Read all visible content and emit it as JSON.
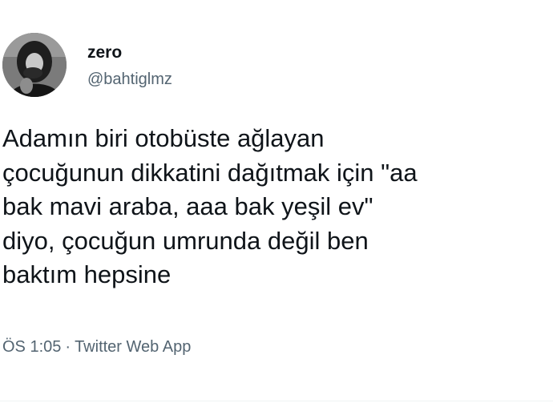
{
  "tweet": {
    "author": {
      "name": "zero",
      "handle": "@bahtiglmz",
      "avatar_icon": "profile-photo"
    },
    "text": "Adamın biri otobüste ağlayan\nçocuğunun dikkatini dağıtmak için \"aa\nbak mavi araba, aaa bak yeşil ev\"\ndiyo, çocuğun umrunda değil ben\nbaktım hepsine",
    "time": "ÖS 1:05",
    "separator": "·",
    "source": "Twitter Web App"
  },
  "colors": {
    "text_primary": "#0f1419",
    "text_secondary": "#536471",
    "background": "#ffffff"
  }
}
